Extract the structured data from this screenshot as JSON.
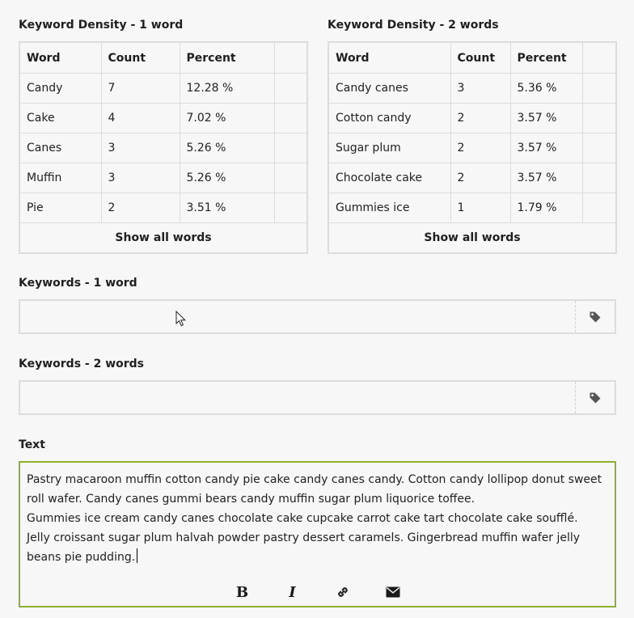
{
  "density_one": {
    "title": "Keyword Density - 1 word",
    "headers": [
      "Word",
      "Count",
      "Percent"
    ],
    "rows": [
      [
        "Candy",
        "7",
        "12.28 %"
      ],
      [
        "Cake",
        "4",
        "7.02 %"
      ],
      [
        "Canes",
        "3",
        "5.26 %"
      ],
      [
        "Muffin",
        "3",
        "5.26 %"
      ],
      [
        "Pie",
        "2",
        "3.51 %"
      ]
    ],
    "show_all_label": "Show all words"
  },
  "density_two": {
    "title": "Keyword Density - 2 words",
    "headers": [
      "Word",
      "Count",
      "Percent"
    ],
    "rows": [
      [
        "Candy canes",
        "3",
        "5.36 %"
      ],
      [
        "Cotton candy",
        "2",
        "3.57 %"
      ],
      [
        "Sugar plum",
        "2",
        "3.57 %"
      ],
      [
        "Chocolate cake",
        "2",
        "3.57 %"
      ],
      [
        "Gummies ice",
        "1",
        "1.79 %"
      ]
    ],
    "show_all_label": "Show all words"
  },
  "keywords_one": {
    "label": "Keywords - 1 word",
    "value": "",
    "icon": "tag-icon"
  },
  "keywords_two": {
    "label": "Keywords - 2 words",
    "value": "",
    "icon": "tag-icon"
  },
  "text": {
    "label": "Text",
    "paragraphs": [
      "Pastry macaroon muffin cotton candy pie cake candy canes candy. Cotton candy lollipop donut sweet roll wafer. Candy canes gummi bears candy muffin sugar plum liquorice toffee.",
      "Gummies ice cream candy canes chocolate cake cupcake carrot cake tart chocolate cake soufflé. Jelly croissant sugar plum halvah powder pastry dessert caramels. Gingerbread muffin wafer jelly beans pie pudding."
    ],
    "toolbar": {
      "bold": "B",
      "italic": "I",
      "link_icon": "link-icon",
      "email_icon": "envelope-icon"
    }
  },
  "colors": {
    "border": "#dcdcdc",
    "focus_border": "#8eb031",
    "background": "#f7f7f7"
  }
}
